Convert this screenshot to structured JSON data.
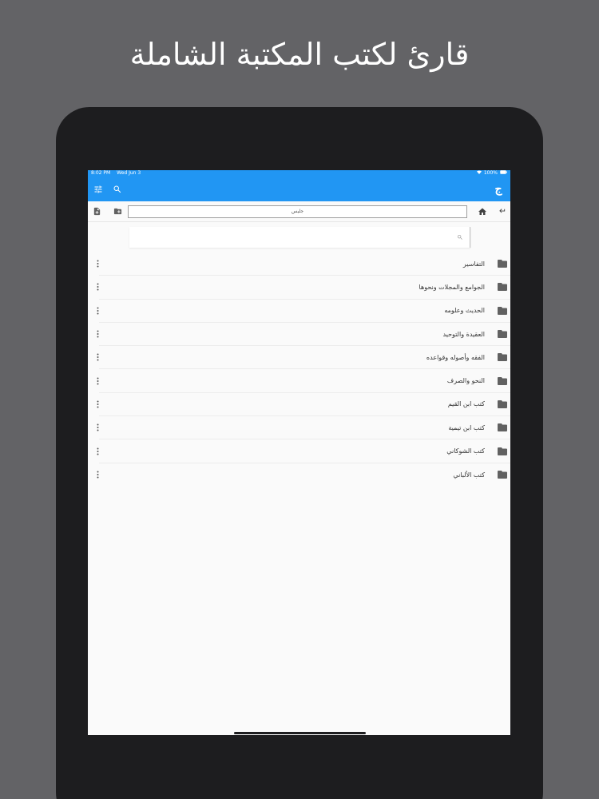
{
  "promo": {
    "title": "قارئ لكتب المكتبة الشاملة"
  },
  "status_bar": {
    "time": "8:02 PM",
    "date": "Wed Jun 3",
    "battery": "100%"
  },
  "app_bar": {
    "logo_text": "ج",
    "icons": [
      "tune-icon",
      "search-icon"
    ]
  },
  "toolbar": {
    "path_label": "جليس",
    "icons": [
      "new-file-icon",
      "new-folder-icon",
      "home-icon",
      "back-icon"
    ]
  },
  "search": {
    "placeholder": ""
  },
  "folders": [
    {
      "label": "التفاسير"
    },
    {
      "label": "الجوامع والمجلات ونحوها"
    },
    {
      "label": "الحديث وعلومه"
    },
    {
      "label": "العقيدة والتوحيد"
    },
    {
      "label": "الفقه وأصوله وقواعده"
    },
    {
      "label": "النحو والصرف"
    },
    {
      "label": "كتب ابن القيم"
    },
    {
      "label": "كتب ابن تيمية"
    },
    {
      "label": "كتب الشوكاني"
    },
    {
      "label": "كتب الألباني"
    }
  ],
  "colors": {
    "background": "#636366",
    "device": "#1d1d1f",
    "accent": "#2196f3",
    "folder_icon": "#616161"
  }
}
